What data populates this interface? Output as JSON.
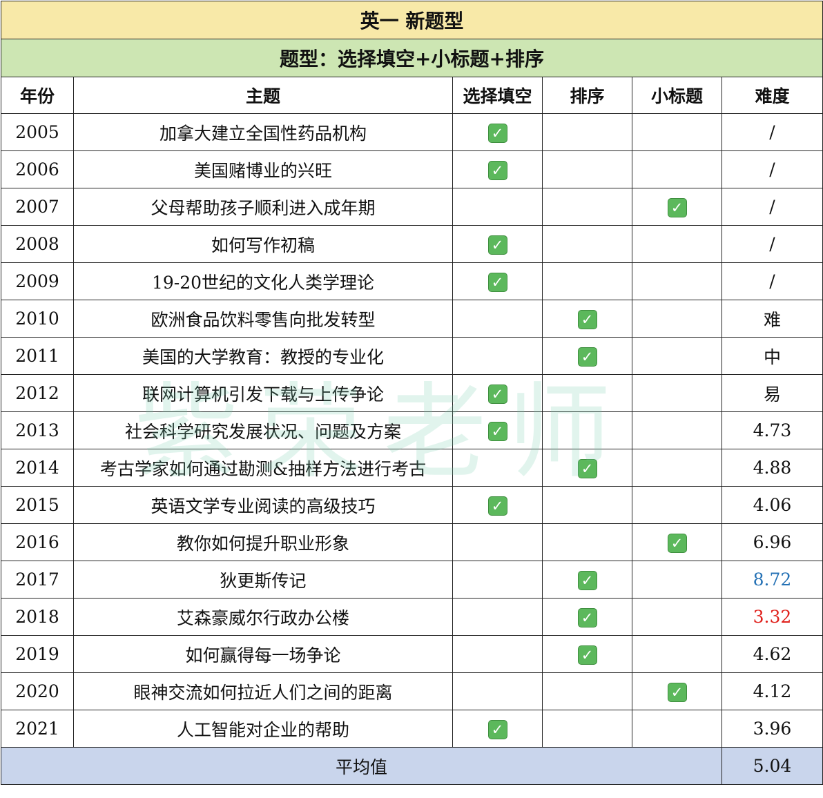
{
  "title": "英一 新题型",
  "subtitle": "题型：选择填空+小标题+排序",
  "headers": [
    "年份",
    "主题",
    "选择填空",
    "排序",
    "小标题",
    "难度"
  ],
  "check_icon": "check-mark-button-icon",
  "accent_colors": {
    "title_bg": "#f8e9a8",
    "subtitle_bg": "#cde6b3",
    "average_bg": "#c9d5ec",
    "check": "#5cb85c",
    "blue_value": "#2471b5",
    "red_value": "#e0201b"
  },
  "rows": [
    {
      "year": "2005",
      "topic": "加拿大建立全国性药品机构",
      "type": "choice",
      "difficulty": "/"
    },
    {
      "year": "2006",
      "topic": "美国赌博业的兴旺",
      "type": "choice",
      "difficulty": "/"
    },
    {
      "year": "2007",
      "topic": "父母帮助孩子顺利进入成年期",
      "type": "heading",
      "difficulty": "/"
    },
    {
      "year": "2008",
      "topic": "如何写作初稿",
      "type": "choice",
      "difficulty": "/"
    },
    {
      "year": "2009",
      "topic": "19-20世纪的文化人类学理论",
      "type": "choice",
      "difficulty": "/"
    },
    {
      "year": "2010",
      "topic": "欧洲食品饮料零售向批发转型",
      "type": "order",
      "difficulty": "难"
    },
    {
      "year": "2011",
      "topic": "美国的大学教育：教授的专业化",
      "type": "order",
      "difficulty": "中"
    },
    {
      "year": "2012",
      "topic": "联网计算机引发下载与上传争论",
      "type": "choice",
      "difficulty": "易"
    },
    {
      "year": "2013",
      "topic": "社会科学研究发展状况、问题及方案",
      "type": "choice",
      "difficulty": "4.73"
    },
    {
      "year": "2014",
      "topic": "考古学家如何通过勘测&抽样方法进行考古",
      "type": "order",
      "difficulty": "4.88"
    },
    {
      "year": "2015",
      "topic": "英语文学专业阅读的高级技巧",
      "type": "choice",
      "difficulty": "4.06"
    },
    {
      "year": "2016",
      "topic": "教你如何提升职业形象",
      "type": "heading",
      "difficulty": "6.96"
    },
    {
      "year": "2017",
      "topic": "狄更斯传记",
      "type": "order",
      "difficulty": "8.72",
      "color": "#2471b5"
    },
    {
      "year": "2018",
      "topic": "艾森豪威尔行政办公楼",
      "type": "order",
      "difficulty": "3.32",
      "color": "#e0201b"
    },
    {
      "year": "2019",
      "topic": "如何赢得每一场争论",
      "type": "order",
      "difficulty": "4.62"
    },
    {
      "year": "2020",
      "topic": "眼神交流如何拉近人们之间的距离",
      "type": "heading",
      "difficulty": "4.12"
    },
    {
      "year": "2021",
      "topic": "人工智能对企业的帮助",
      "type": "choice",
      "difficulty": "3.96"
    }
  ],
  "average": {
    "label": "平均值",
    "value": "5.04"
  },
  "watermark": "紫荣老师"
}
